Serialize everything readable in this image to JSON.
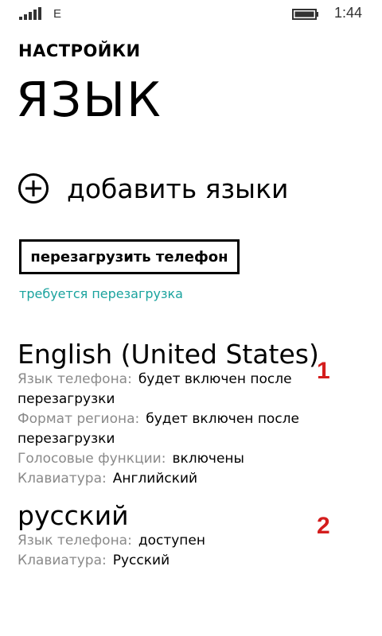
{
  "status_bar": {
    "network_type": "E",
    "time": "1:44",
    "signal_icon": "signal-strength-icon",
    "battery_icon": "battery-icon"
  },
  "header": {
    "app_title": "НАСТРОЙКИ",
    "page_title": "ЯЗЫК"
  },
  "add_languages": {
    "icon": "plus-circle-icon",
    "label": "добавить языки"
  },
  "restart": {
    "button_label": "перезагрузить телефон",
    "note": "требуется перезагрузка"
  },
  "languages": [
    {
      "name": "English (United States)",
      "marker": "1",
      "details": [
        {
          "label": "Язык телефона:",
          "value": "будет включен после перезагрузки"
        },
        {
          "label": "Формат региона:",
          "value": "будет включен после перезагрузки"
        },
        {
          "label": "Голосовые функции:",
          "value": "включены"
        },
        {
          "label": "Клавиатура:",
          "value": "Английский"
        }
      ]
    },
    {
      "name": "русский",
      "marker": "2",
      "details": [
        {
          "label": "Язык телефона:",
          "value": "доступен"
        },
        {
          "label": "Клавиатура:",
          "value": "Русский"
        }
      ]
    }
  ],
  "colors": {
    "accent": "#1aa39e",
    "marker": "#d41d1d",
    "label_gray": "#8a8a8a"
  }
}
